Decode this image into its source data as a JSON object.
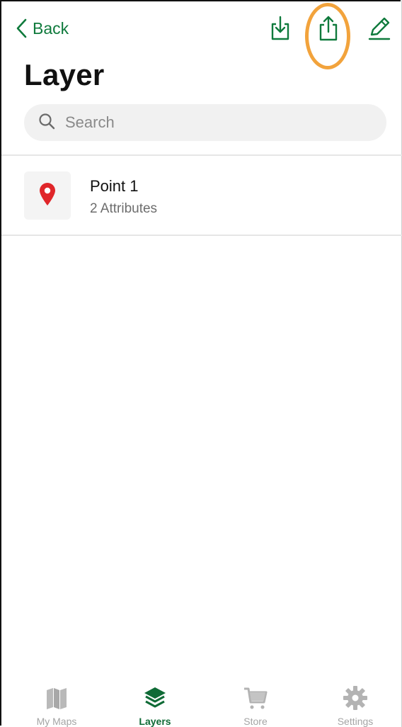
{
  "nav": {
    "back_label": "Back",
    "icons": [
      "back-chevron-icon",
      "download-icon",
      "share-icon",
      "edit-pencil-icon"
    ],
    "highlighted_action": "share-icon"
  },
  "page": {
    "title": "Layer"
  },
  "search": {
    "placeholder": "Search",
    "value": ""
  },
  "layers": [
    {
      "name": "Point 1",
      "subtitle": "2 Attributes",
      "icon": "map-pin-icon"
    }
  ],
  "tabbar": {
    "tabs": [
      {
        "label": "My Maps",
        "icon": "map-icon",
        "active": false
      },
      {
        "label": "Layers",
        "icon": "layers-icon",
        "active": true
      },
      {
        "label": "Store",
        "icon": "cart-icon",
        "active": false
      },
      {
        "label": "Settings",
        "icon": "gear-icon",
        "active": false
      }
    ]
  },
  "colors": {
    "accent": "#0f7a3c",
    "highlight": "#f2a33c",
    "pin": "#e0262a",
    "inactive": "#a5a5a5"
  }
}
